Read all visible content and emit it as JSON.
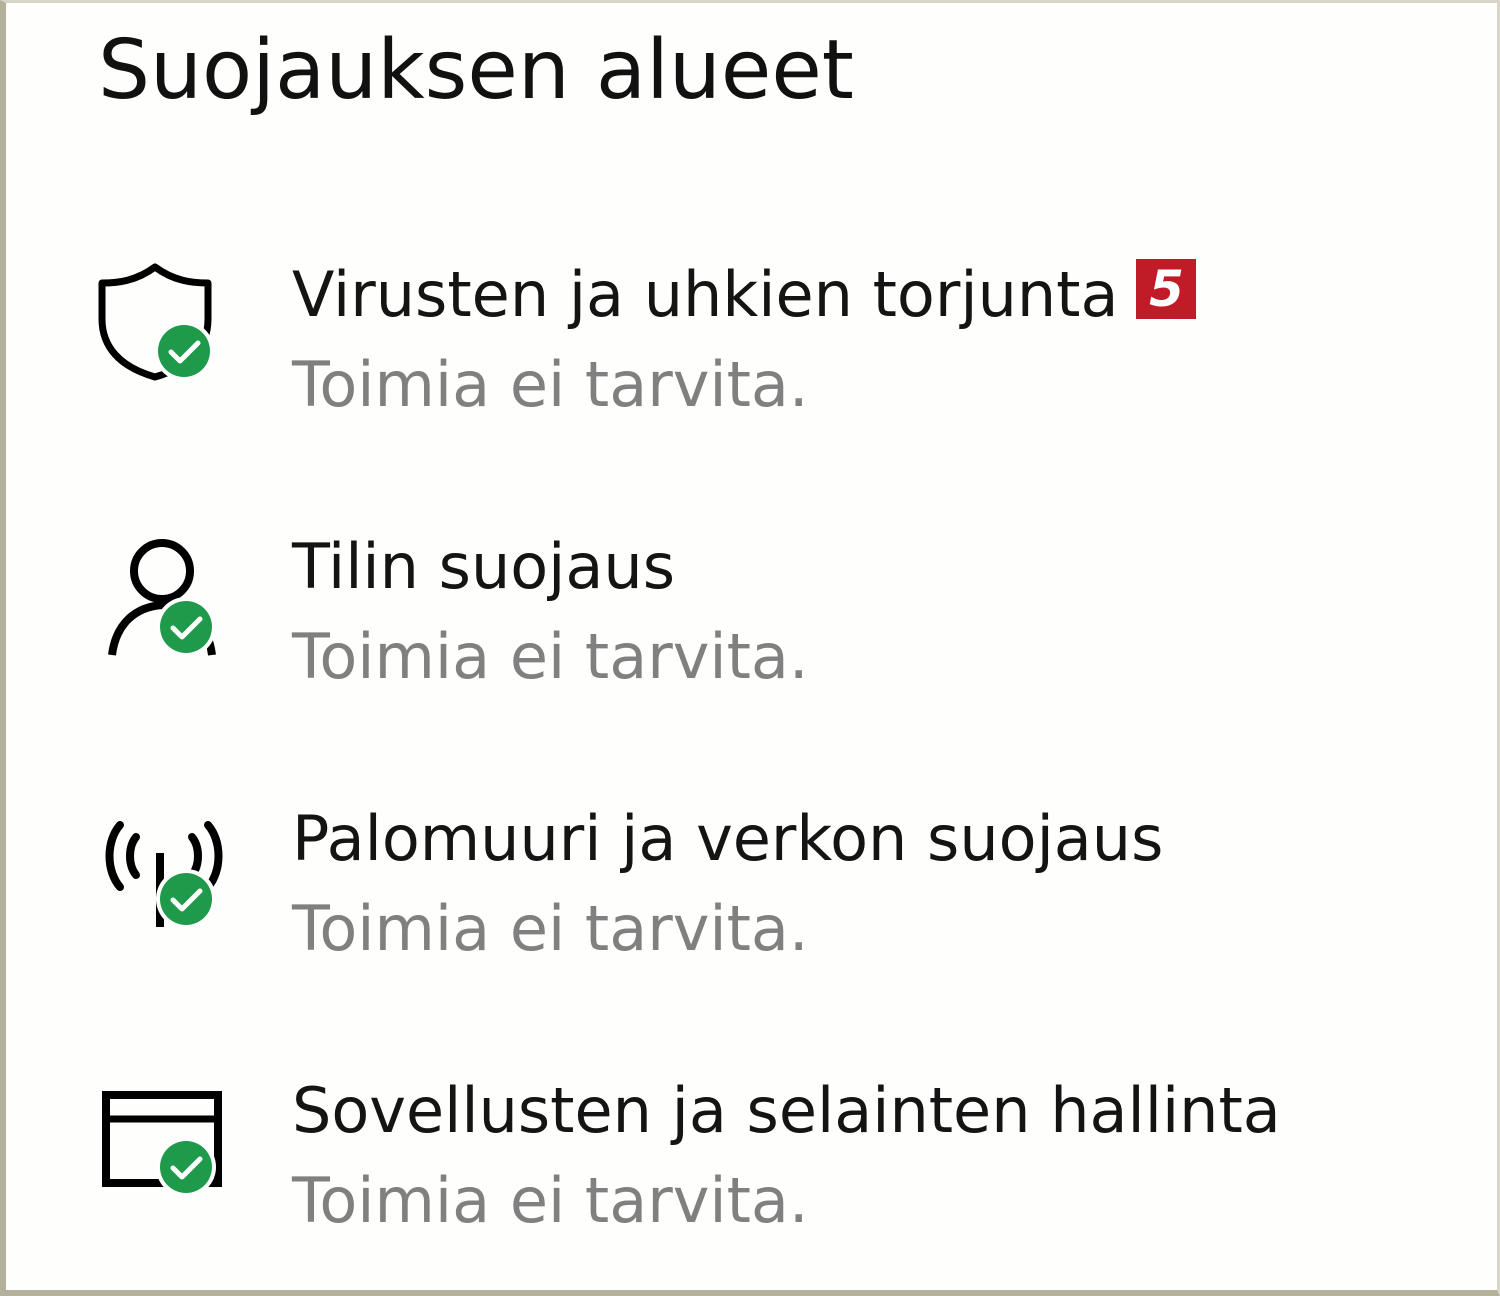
{
  "title": "Suojauksen alueet",
  "colors": {
    "check_green": "#1e9a4a",
    "badge_red": "#c01c28",
    "status_gray": "#808080",
    "text_dark": "#141414"
  },
  "areas": [
    {
      "icon": "shield-check-icon",
      "label": "Virusten ja uhkien torjunta",
      "badge": "5",
      "status": "Toimia ei tarvita."
    },
    {
      "icon": "person-check-icon",
      "label": "Tilin suojaus",
      "status": "Toimia ei tarvita."
    },
    {
      "icon": "antenna-check-icon",
      "label": "Palomuuri ja verkon suojaus",
      "status": "Toimia ei tarvita."
    },
    {
      "icon": "browser-window-check-icon",
      "label": "Sovellusten ja selainten hallinta",
      "status": "Toimia ei tarvita."
    }
  ]
}
